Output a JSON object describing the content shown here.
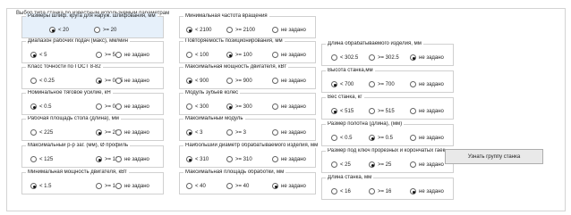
{
  "section_title": "Выбор типа станка по известным используемым параметрам",
  "button_label": "Узнать группу станка",
  "groups": [
    {
      "title": "Размеры шлиф. круга для наруж. шлифования, мм",
      "options": [
        "< 20",
        ">= 20"
      ],
      "selected": 0
    },
    {
      "title": "Диапазон рабочих подач (макс), мм/мин",
      "options": [
        "< 5",
        ">= 5",
        "не задано"
      ],
      "selected": 0
    },
    {
      "title": "Класс точности по ГОСТ 8-82",
      "options": [
        "< 0.25",
        ">= 0.25",
        "не задано"
      ],
      "selected": 1
    },
    {
      "title": "Номинальное тяговое усилие, кН",
      "options": [
        "< 0.5",
        ">= 0.5",
        "не задано"
      ],
      "selected": 0
    },
    {
      "title": "Рабочая площадь стола (длина), мм",
      "options": [
        "< 225",
        ">= 225",
        "не задано"
      ],
      "selected": 1
    },
    {
      "title": "Максимальный р-р заг. (мм), Ø профиль",
      "options": [
        "< 125",
        ">= 125",
        "не задано"
      ],
      "selected": 1
    },
    {
      "title": "Минимальная мощность двигателя, кВт",
      "options": [
        "< 1.5",
        ">= 1.5",
        "не задано"
      ],
      "selected": 0
    },
    {
      "title": "Минимальная частота вращения",
      "options": [
        "< 2100",
        ">= 2100",
        "не задано"
      ],
      "selected": 0
    },
    {
      "title": "Повторяемость позиционирования, мм",
      "options": [
        "< 100",
        ">= 100",
        "не задано"
      ],
      "selected": 1
    },
    {
      "title": "Максимальная мощность двигателя, кВт",
      "options": [
        "< 900",
        ">= 900",
        "не задано"
      ],
      "selected": 0
    },
    {
      "title": "Модуль зубьев колес",
      "options": [
        "< 300",
        ">= 300",
        "не задано"
      ],
      "selected": 1
    },
    {
      "title": "Максимальный модуль",
      "options": [
        "< 3",
        ">= 3",
        "не задано"
      ],
      "selected": 0
    },
    {
      "title": "Наибольший диаметр обрабатываемого изделия, мм",
      "options": [
        "< 310",
        ">= 310",
        "не задано"
      ],
      "selected": 0
    },
    {
      "title": "Максимальная площадь обработки, мм",
      "options": [
        "< 40",
        ">= 40",
        "не задано"
      ],
      "selected": 2
    },
    {
      "title": "Длина обрабатываемого изделия, мм",
      "options": [
        "< 302.5",
        ">= 302.5",
        "не задано"
      ],
      "selected": 2
    },
    {
      "title": "Высота станка,мм",
      "options": [
        "< 700",
        ">= 700",
        "не задано"
      ],
      "selected": 0
    },
    {
      "title": "Вес станка, кг",
      "options": [
        "< 515",
        ">= 515",
        "не задано"
      ],
      "selected": 0
    },
    {
      "title": "Размер полотна (длина), (мм)",
      "options": [
        "< 0.5",
        ">= 0.5",
        "не задано"
      ],
      "selected": 1
    },
    {
      "title": "Размер под ключ прорезных и корончатых гаек",
      "options": [
        "< 25",
        ">= 25",
        "не задано"
      ],
      "selected": 1
    },
    {
      "title": "Длина станка, мм",
      "options": [
        "< 16",
        ">= 16",
        "не задано"
      ],
      "selected": 2
    }
  ]
}
